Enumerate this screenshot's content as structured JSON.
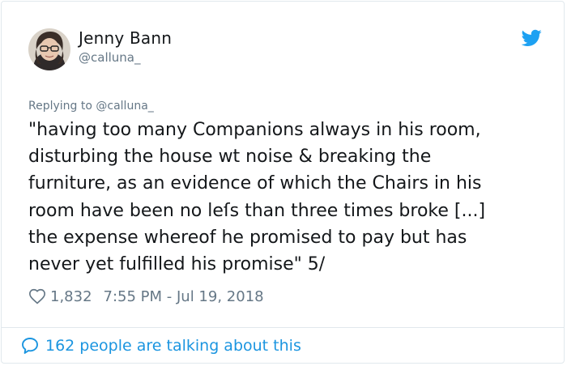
{
  "author": {
    "name": "Jenny Bann",
    "handle": "@calluna_"
  },
  "reply": {
    "prefix": "Replying to ",
    "handle": "@calluna_"
  },
  "tweet": {
    "text": "\"having too many Companions always in his room,\ndisturbing the house wt noise & breaking the\nfurniture, as an evidence of which the Chairs in his\nroom have been no leſs than three times broke [...]\nthe expense whereof he promised to pay but has\nnever yet fulfilled his promise\" 5/"
  },
  "meta": {
    "likes": "1,832",
    "timestamp": "7:55 PM - Jul 19, 2018"
  },
  "footer": {
    "talking": "162 people are talking about this"
  },
  "colors": {
    "twitter_blue": "#1da1f2",
    "link_blue": "#1b95e0",
    "secondary_text": "#657786",
    "border": "#e1e8ed"
  },
  "icons": {
    "brand": "twitter-bird-icon",
    "like": "heart-outline-icon",
    "reply_bubble": "speech-bubble-icon"
  }
}
